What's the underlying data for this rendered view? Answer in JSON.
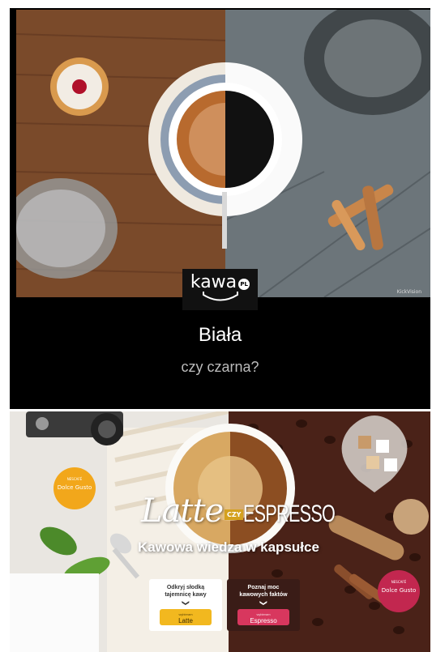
{
  "top_panel": {
    "logo_text": "kawa",
    "logo_badge": "PL",
    "question_main": "Biała",
    "question_sub": "czy czarna?",
    "watermark": "KickVision"
  },
  "bottom_panel": {
    "title_left": "Latte",
    "title_connector": "CZY",
    "title_right": "ESPRESSO",
    "subtitle": "Kawowa wiedza w kapsułce",
    "cards": [
      {
        "text_line1": "Odkryj słodką",
        "text_line2": "tajemnicę kawy",
        "button_small": "wybieram",
        "button_label": "Latte"
      },
      {
        "text_line1": "Poznaj moc",
        "text_line2": "kawowych faktów",
        "button_small": "wybieram",
        "button_label": "Espresso"
      }
    ],
    "capsule_brand_1": "NESCAFÉ",
    "capsule_brand_2": "Dolce Gusto"
  },
  "colors": {
    "latte_button": "#f2b81f",
    "espresso_button": "#d8375e",
    "espresso_card": "#3a1c17"
  }
}
